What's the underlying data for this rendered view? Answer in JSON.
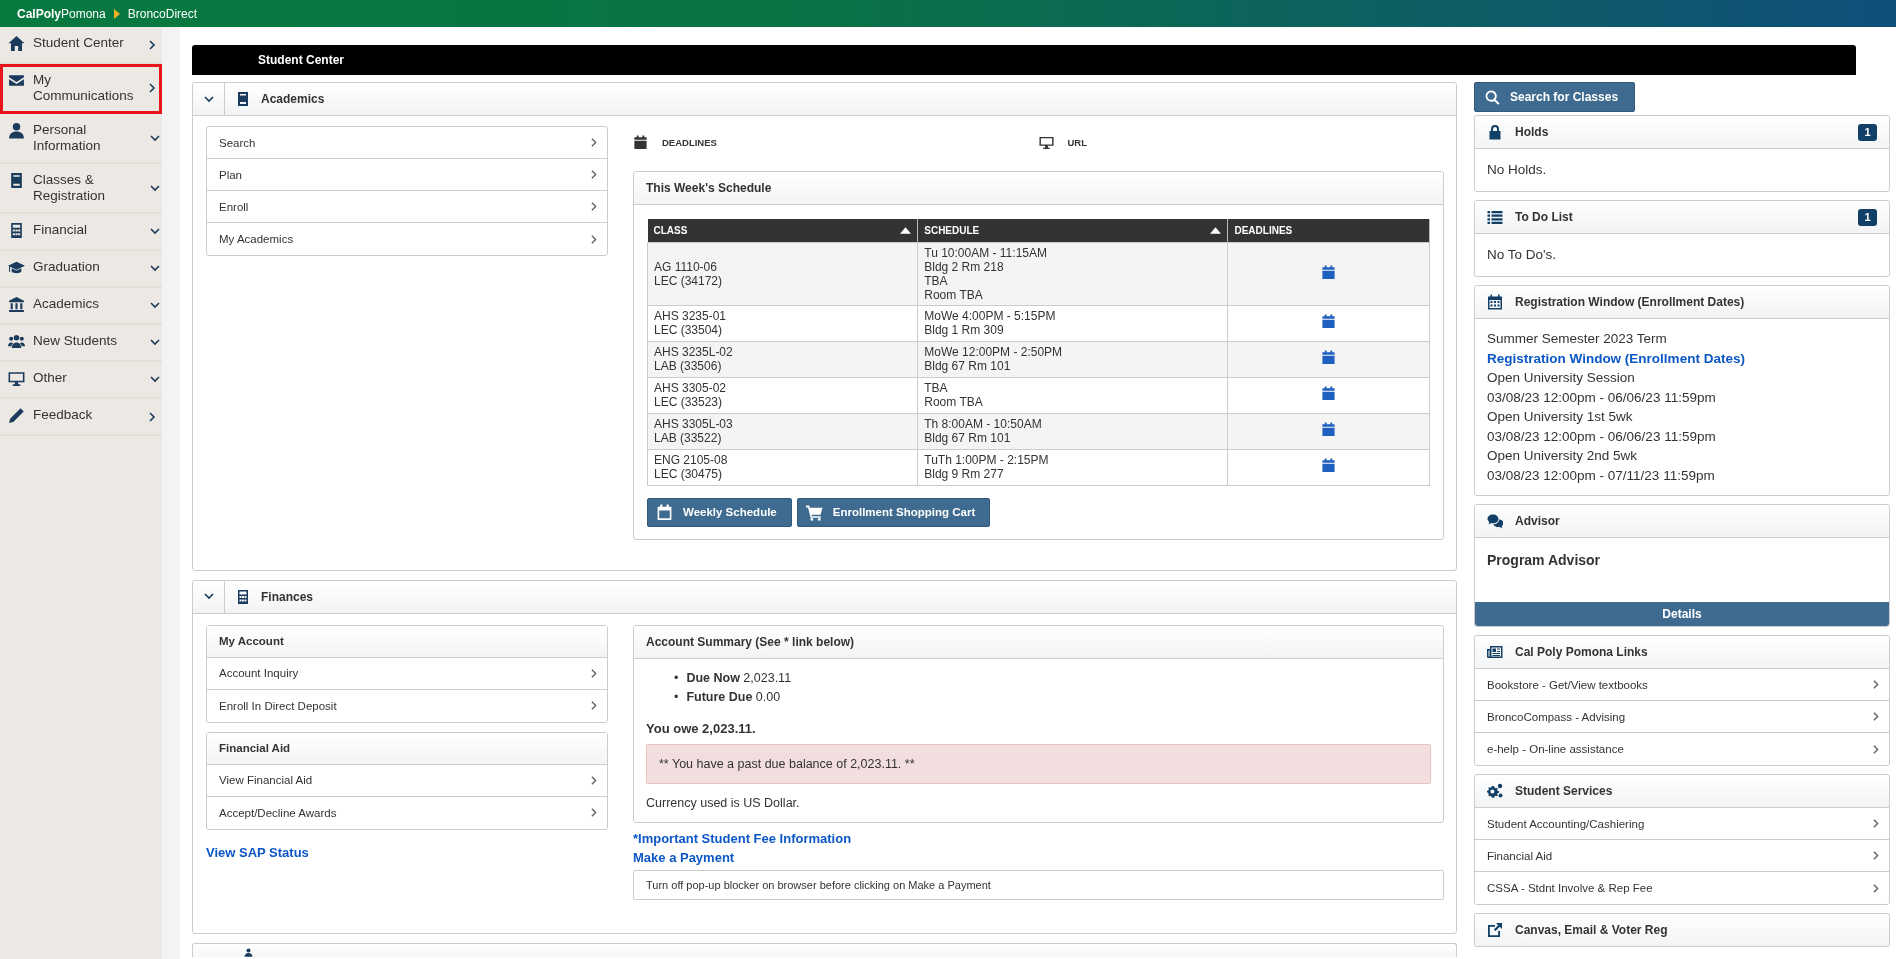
{
  "top_bar": {
    "brand_bold": "CalPoly",
    "brand_light": "Pomona",
    "breadcrumb": "BroncoDirect"
  },
  "sidebar": {
    "items": [
      {
        "label": "Student Center",
        "kind": "link",
        "selected": false
      },
      {
        "label": "My Communications",
        "kind": "link",
        "selected": true
      },
      {
        "label": "Personal Information",
        "kind": "menu",
        "selected": false
      },
      {
        "label": "Classes & Registration",
        "kind": "menu",
        "selected": false
      },
      {
        "label": "Financial",
        "kind": "menu",
        "selected": false
      },
      {
        "label": "Graduation",
        "kind": "menu",
        "selected": false
      },
      {
        "label": "Academics",
        "kind": "menu",
        "selected": false
      },
      {
        "label": "New Students",
        "kind": "menu",
        "selected": false
      },
      {
        "label": "Other",
        "kind": "menu",
        "selected": false
      },
      {
        "label": "Feedback",
        "kind": "link",
        "selected": false
      }
    ]
  },
  "page_header": {
    "title": "Student Center"
  },
  "academics": {
    "title": "Academics",
    "expanded": true,
    "nav": [
      "Search",
      "Plan",
      "Enroll",
      "My Academics"
    ],
    "quick_links": [
      "DEADLINES",
      "URL"
    ],
    "schedule": {
      "title": "This Week's Schedule",
      "columns": [
        {
          "label": "CLASS",
          "sortable": true
        },
        {
          "label": "SCHEDULE",
          "sortable": true
        },
        {
          "label": "DEADLINES",
          "sortable": false
        }
      ],
      "rows": [
        {
          "class": [
            "AG 1110-06",
            "LEC (34172)"
          ],
          "schedule": [
            "Tu 10:00AM - 11:15AM",
            "Bldg 2 Rm 218",
            "TBA",
            "Room  TBA"
          ]
        },
        {
          "class": [
            "AHS 3235-01",
            "LEC (33504)"
          ],
          "schedule": [
            "MoWe 4:00PM - 5:15PM",
            "Bldg 1 Rm 309"
          ]
        },
        {
          "class": [
            "AHS 3235L-02",
            "LAB (33506)"
          ],
          "schedule": [
            "MoWe 12:00PM - 2:50PM",
            "Bldg 67 Rm 101"
          ]
        },
        {
          "class": [
            "AHS 3305-02",
            "LEC (33523)"
          ],
          "schedule": [
            "TBA",
            "Room  TBA"
          ]
        },
        {
          "class": [
            "AHS 3305L-03",
            "LAB (33522)"
          ],
          "schedule": [
            "Th 8:00AM - 10:50AM",
            "Bldg 67 Rm 101"
          ]
        },
        {
          "class": [
            "ENG 2105-08",
            "LEC (30475)"
          ],
          "schedule": [
            "TuTh 1:00PM - 2:15PM",
            "Bldg 9 Rm 277"
          ]
        }
      ],
      "buttons": [
        "Weekly Schedule",
        "Enrollment Shopping Cart"
      ]
    }
  },
  "finances": {
    "title": "Finances",
    "expanded": true,
    "my_account": {
      "title": "My Account",
      "items": [
        "Account Inquiry",
        "Enroll In Direct Deposit"
      ]
    },
    "financial_aid": {
      "title": "Financial Aid",
      "items": [
        "View Financial Aid",
        "Accept/Decline Awards"
      ]
    },
    "sap_link": "View SAP Status",
    "summary": {
      "title": "Account Summary (See * link below)",
      "items": [
        {
          "bullet": "•",
          "label": "Due Now",
          "value": "2,023.11"
        },
        {
          "bullet": "•",
          "label": "Future Due",
          "value": "0.00"
        }
      ],
      "owe": "You owe 2,023.11.",
      "alert": "** You have a past due balance of 2,023.11. **",
      "currency": "Currency used is US Dollar."
    },
    "links": [
      "*Important Student Fee Information",
      "Make a Payment"
    ],
    "note": "Turn off pop-up blocker on browser before clicking on Make a Payment"
  },
  "right": {
    "search_button": "Search for Classes",
    "holds": {
      "title": "Holds",
      "badge": "1",
      "text": "No Holds."
    },
    "todo": {
      "title": "To Do List",
      "badge": "1",
      "text": "No To Do's."
    },
    "registration": {
      "title": "Registration Window (Enrollment Dates)",
      "term": "Summer Semester 2023 Term",
      "link": "Registration Window (Enrollment Dates)",
      "sessions": [
        {
          "name": "Open University Session",
          "dates": "03/08/23 12:00pm - 06/06/23 11:59pm"
        },
        {
          "name": "Open University 1st 5wk",
          "dates": "03/08/23 12:00pm - 06/06/23 11:59pm"
        },
        {
          "name": "Open University 2nd 5wk",
          "dates": "03/08/23 12:00pm - 07/11/23 11:59pm"
        }
      ]
    },
    "advisor": {
      "title": "Advisor",
      "name": "Program Advisor",
      "button": "Details"
    },
    "cpp_links": {
      "title": "Cal Poly Pomona Links",
      "items": [
        "Bookstore - Get/View textbooks",
        "BroncoCompass - Advising",
        "e-help - On-line assistance"
      ]
    },
    "student_services": {
      "title": "Student Services",
      "items": [
        "Student Accounting/Cashiering",
        "Financial Aid",
        "CSSA - Stdnt Involve & Rep Fee"
      ]
    },
    "canvas": {
      "title": "Canvas, Email & Voter Reg"
    }
  }
}
